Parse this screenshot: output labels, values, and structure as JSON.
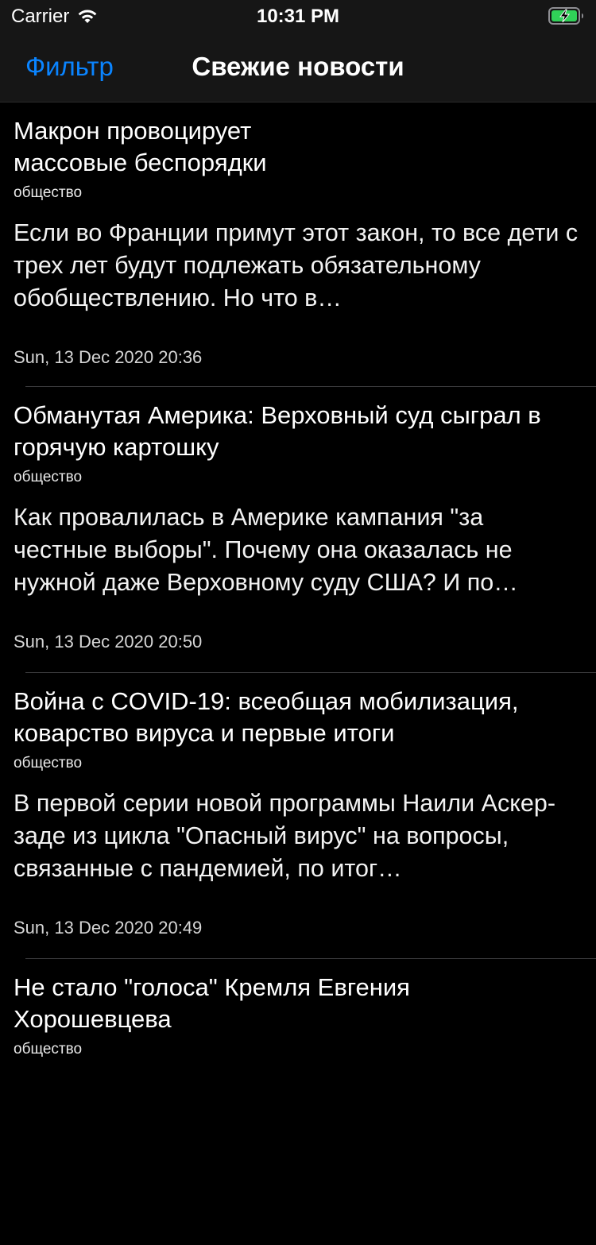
{
  "status_bar": {
    "carrier": "Carrier",
    "time": "10:31 PM"
  },
  "nav": {
    "filter_label": "Фильтр",
    "title": "Свежие новости"
  },
  "colors": {
    "accent": "#0a84ff",
    "background": "#000000",
    "battery_green": "#30d158"
  },
  "news": [
    {
      "title": "Макрон провоцирует массовые беспорядки",
      "category": "общество",
      "preview": "Если во Франции примут этот закон, то все дети с трех лет будут подлежать обязательному обобществлению. Но что в…",
      "date": "Sun, 13 Dec 2020 20:36"
    },
    {
      "title": "Обманутая Америка: Верховный суд сыграл в горячую картошку",
      "category": "общество",
      "preview": "Как провалилась в Америке кампания \"за честные выборы\". Почему она оказалась не нужной даже Верховному суду США? И по…",
      "date": "Sun, 13 Dec 2020 20:50"
    },
    {
      "title": "Война с COVID-19: всеобщая мобилизация, коварство вируса и первые итоги",
      "category": "общество",
      "preview": "В первой серии новой программы Наили Аскер-заде из цикла \"Опасный вирус\" на вопросы, связанные с пандемией, по итог…",
      "date": "Sun, 13 Dec 2020 20:49"
    },
    {
      "title": "Не стало \"голоса\" Кремля Евгения Хорошевцева",
      "category": "общество",
      "preview": "",
      "date": ""
    }
  ]
}
